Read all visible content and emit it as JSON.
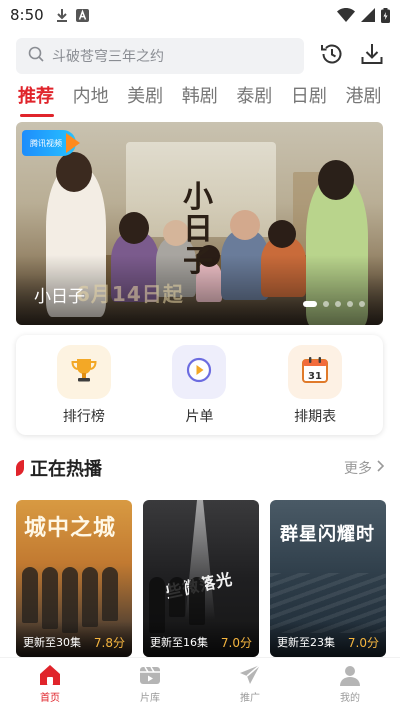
{
  "status_bar": {
    "time": "8:50",
    "download_icon": "download-arrow-icon",
    "app_icon": "a-square-icon",
    "wifi_icon": "wifi-icon",
    "signal_icon": "signal-icon",
    "battery_icon": "battery-icon"
  },
  "header": {
    "search_placeholder": "斗破苍穹三年之约",
    "history_icon": "history-clock-icon",
    "download_icon": "download-icon"
  },
  "tabs": [
    {
      "label": "推荐",
      "active": true
    },
    {
      "label": "内地",
      "active": false
    },
    {
      "label": "美剧",
      "active": false
    },
    {
      "label": "韩剧",
      "active": false
    },
    {
      "label": "泰剧",
      "active": false
    },
    {
      "label": "日剧",
      "active": false
    },
    {
      "label": "港剧",
      "active": false
    }
  ],
  "banner": {
    "caption": "小日子",
    "art_title": "小日子",
    "art_date": "6月14日起",
    "logo_text": "腾讯视频",
    "dots_count": 5,
    "active_dot": 1
  },
  "shortcuts": [
    {
      "label": "排行榜",
      "icon": "trophy-icon",
      "bg": "#fdf3e1"
    },
    {
      "label": "片单",
      "icon": "play-circle-icon",
      "bg": "#eeeefb"
    },
    {
      "label": "排期表",
      "icon": "calendar-icon",
      "bg": "#fdf1e4",
      "calendar_day": "31"
    }
  ],
  "hot_section": {
    "title": "正在热播",
    "more_label": "更多",
    "cards": [
      {
        "art_title": "城中之城",
        "episodes": "更新至30集",
        "score": "7.8分"
      },
      {
        "art_title": "些微落光",
        "episodes": "更新至16集",
        "score": "7.0分"
      },
      {
        "art_title": "群星闪耀时",
        "episodes": "更新至23集",
        "score": "7.0分"
      }
    ]
  },
  "bottom_nav": [
    {
      "label": "首页",
      "icon": "home-icon",
      "active": true
    },
    {
      "label": "片库",
      "icon": "film-library-icon",
      "active": false
    },
    {
      "label": "推广",
      "icon": "paper-plane-icon",
      "active": false
    },
    {
      "label": "我的",
      "icon": "user-icon",
      "active": false
    }
  ],
  "colors": {
    "accent": "#e0242b",
    "score": "#f5b53f",
    "tab_inactive": "#777777",
    "search_bg": "#f1f2f4"
  }
}
